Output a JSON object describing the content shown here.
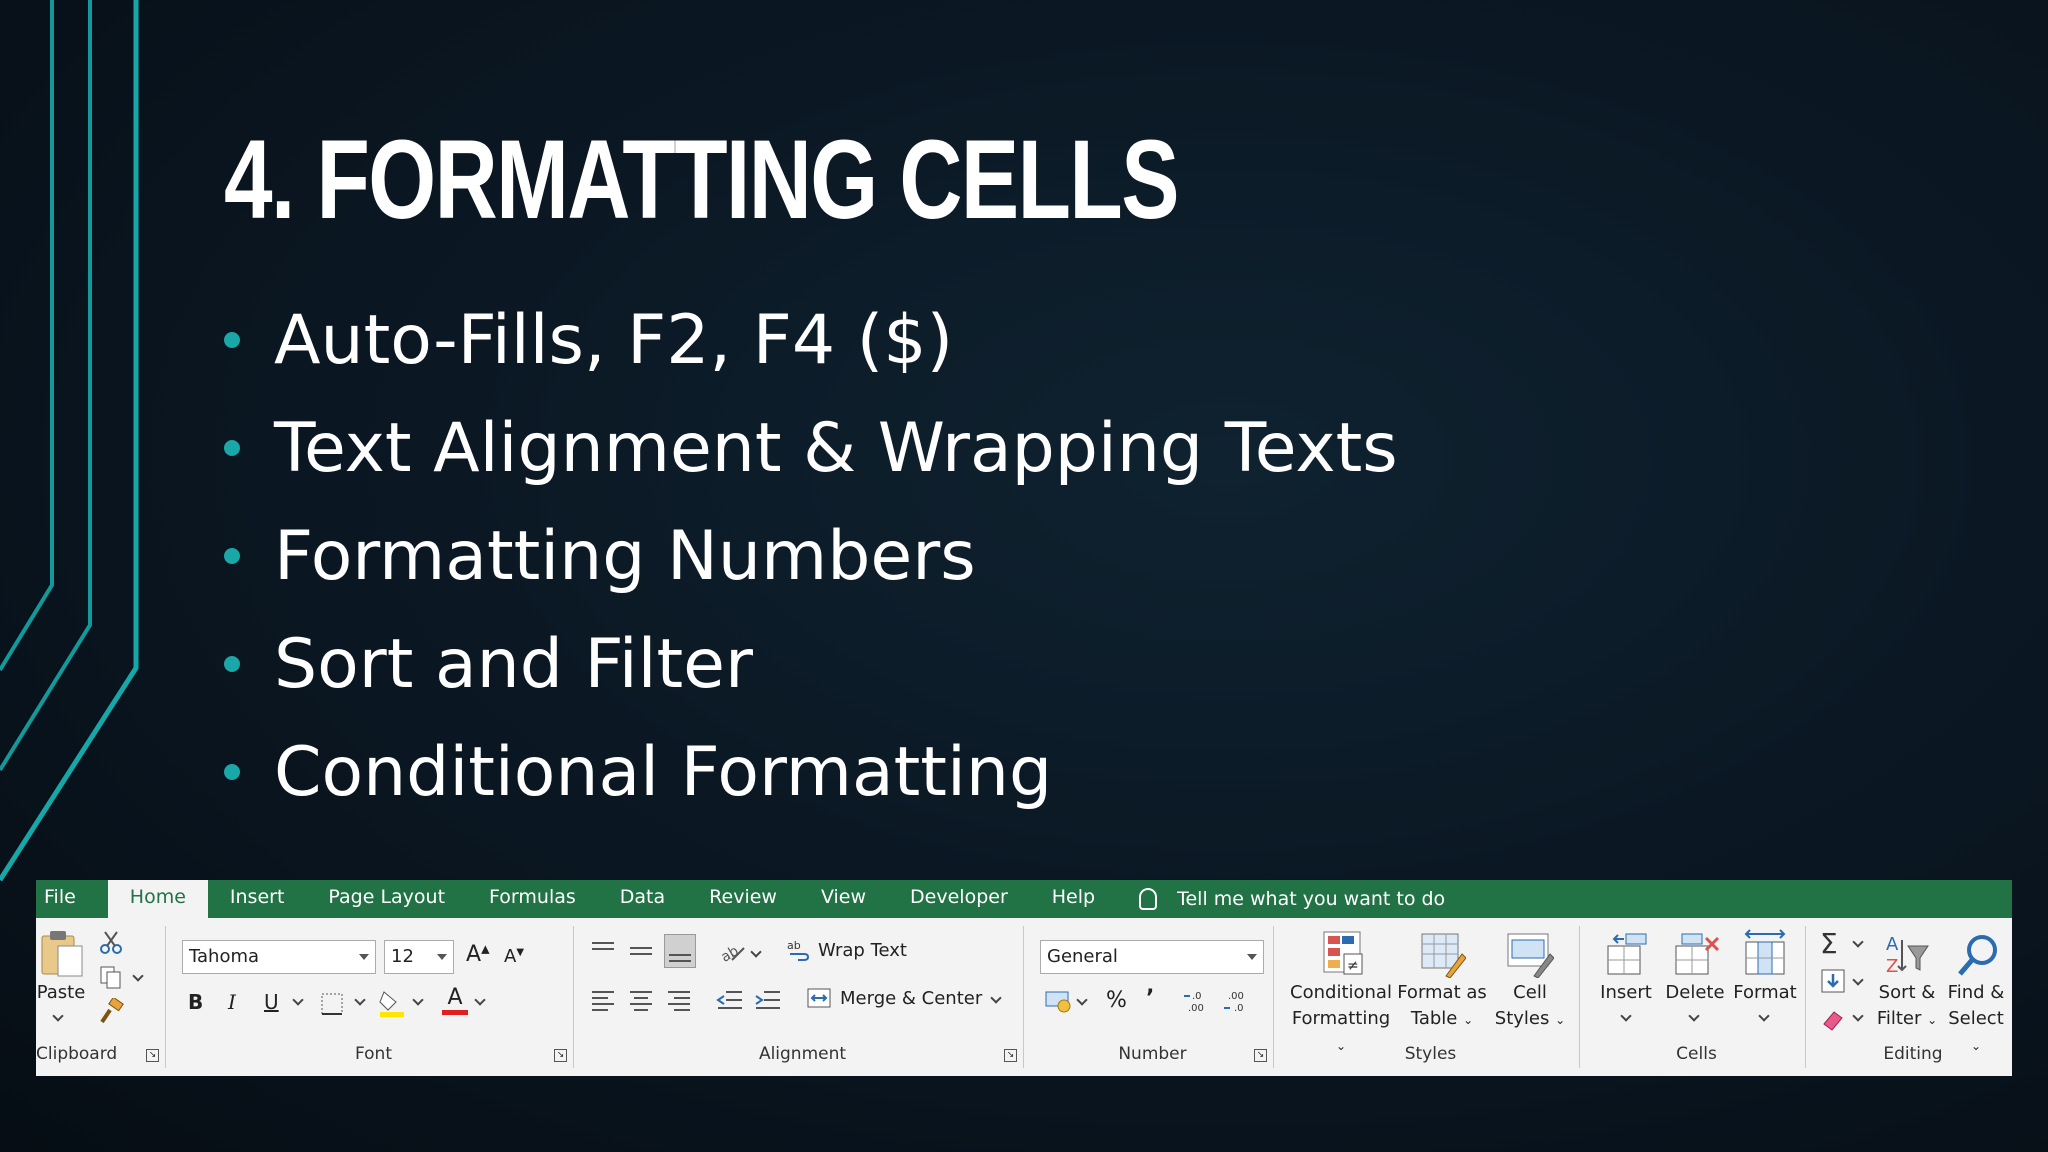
{
  "slide": {
    "title": "4. FORMATTING CELLS",
    "bullets": [
      "Auto-Fills, F2, F4 ($)",
      "Text Alignment & Wrapping Texts",
      "Formatting Numbers",
      "Sort and Filter",
      "Conditional Formatting"
    ]
  },
  "ribbon": {
    "tabs": [
      "File",
      "Home",
      "Insert",
      "Page Layout",
      "Formulas",
      "Data",
      "Review",
      "View",
      "Developer",
      "Help"
    ],
    "active_tab": "Home",
    "tell_me": "Tell me what you want to do",
    "groups": {
      "clipboard": {
        "label": "Clipboard",
        "paste": "Paste"
      },
      "font": {
        "label": "Font",
        "font_name": "Tahoma",
        "font_size": "12",
        "bold": "B",
        "italic": "I",
        "underline": "U",
        "grow": "A",
        "shrink": "A",
        "font_color": "A"
      },
      "alignment": {
        "label": "Alignment",
        "wrap_text": "Wrap Text",
        "merge_center": "Merge & Center"
      },
      "number": {
        "label": "Number",
        "format": "General",
        "percent": "%",
        "comma": "’"
      },
      "styles": {
        "label": "Styles",
        "conditional_1": "Conditional",
        "conditional_2": "Formatting",
        "format_table_1": "Format as",
        "format_table_2": "Table",
        "cell_styles_1": "Cell",
        "cell_styles_2": "Styles"
      },
      "cells": {
        "label": "Cells",
        "insert": "Insert",
        "delete": "Delete",
        "format": "Format"
      },
      "editing": {
        "label": "Editing",
        "sort_1": "Sort &",
        "sort_2": "Filter",
        "find_1": "Find &",
        "find_2": "Select",
        "sigma": "Σ"
      }
    }
  },
  "colors": {
    "ribbon_green": "#217346",
    "accent_teal": "#19a7a7"
  }
}
